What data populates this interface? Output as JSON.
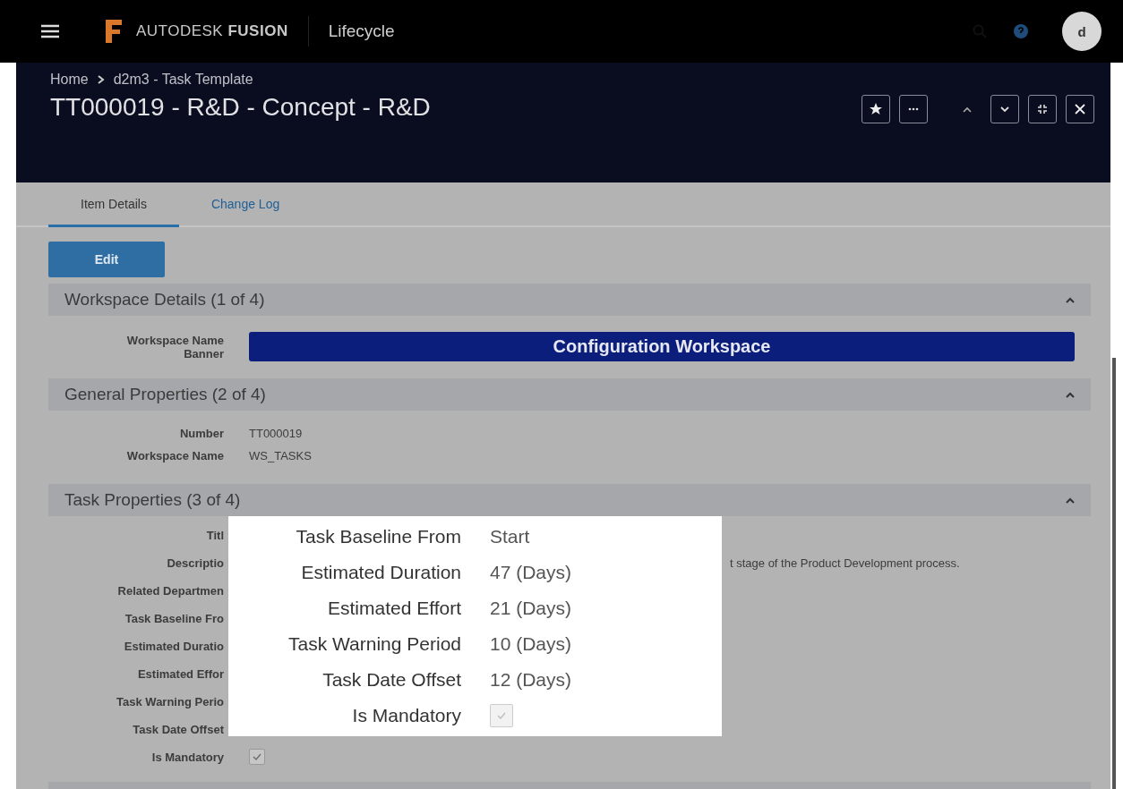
{
  "top_bar": {
    "brand": "AUTODESK",
    "product": "FUSION",
    "app": "Lifecycle",
    "avatar": "d"
  },
  "breadcrumb": [
    "Home",
    "d2m3 - Task Template"
  ],
  "title": "TT000019 - R&D - Concept - R&D",
  "tabs": [
    {
      "label": "Item Details",
      "selected": true
    },
    {
      "label": "Change Log",
      "selected": false
    }
  ],
  "edit_button": "Edit",
  "sections": [
    {
      "title": "Workspace Details (1 of 4)",
      "expanded": true,
      "fields": [
        {
          "kind": "banner",
          "label": "Workspace Name Banner",
          "value": "Configuration Workspace"
        }
      ]
    },
    {
      "title": "General Properties (2 of 4)",
      "expanded": true,
      "fields": [
        {
          "kind": "text",
          "label": "Number",
          "value": "TT000019"
        },
        {
          "kind": "text",
          "label": "Workspace Name",
          "value": "WS_TASKS"
        }
      ]
    },
    {
      "title": "Task Properties (3 of 4)",
      "expanded": true,
      "fields": [
        {
          "kind": "text",
          "label": "Titl"
        },
        {
          "kind": "text",
          "label": "Descriptio",
          "value": "t stage of the Product Development process."
        },
        {
          "kind": "text",
          "label": "Related Departmen"
        },
        {
          "kind": "text",
          "label": "Task Baseline Fro"
        },
        {
          "kind": "text",
          "label": "Estimated Duratio"
        },
        {
          "kind": "text",
          "label": "Estimated Effor"
        },
        {
          "kind": "text",
          "label": "Task Warning Perio"
        },
        {
          "kind": "text",
          "label": "Task Date Offset"
        },
        {
          "kind": "checkbox",
          "label": "Is Mandatory",
          "checked": true
        }
      ]
    }
  ],
  "callout": [
    {
      "kind": "text",
      "label": "Task Baseline From",
      "value": "Start"
    },
    {
      "kind": "text",
      "label": "Estimated Duration",
      "value": "47 (Days)"
    },
    {
      "kind": "text",
      "label": "Estimated Effort",
      "value": "21 (Days)"
    },
    {
      "kind": "text",
      "label": "Task Warning Period",
      "value": "10 (Days)"
    },
    {
      "kind": "text",
      "label": "Task Date Offset",
      "value": "12 (Days)"
    },
    {
      "kind": "checkbox",
      "label": "Is Mandatory",
      "checked": true
    }
  ]
}
